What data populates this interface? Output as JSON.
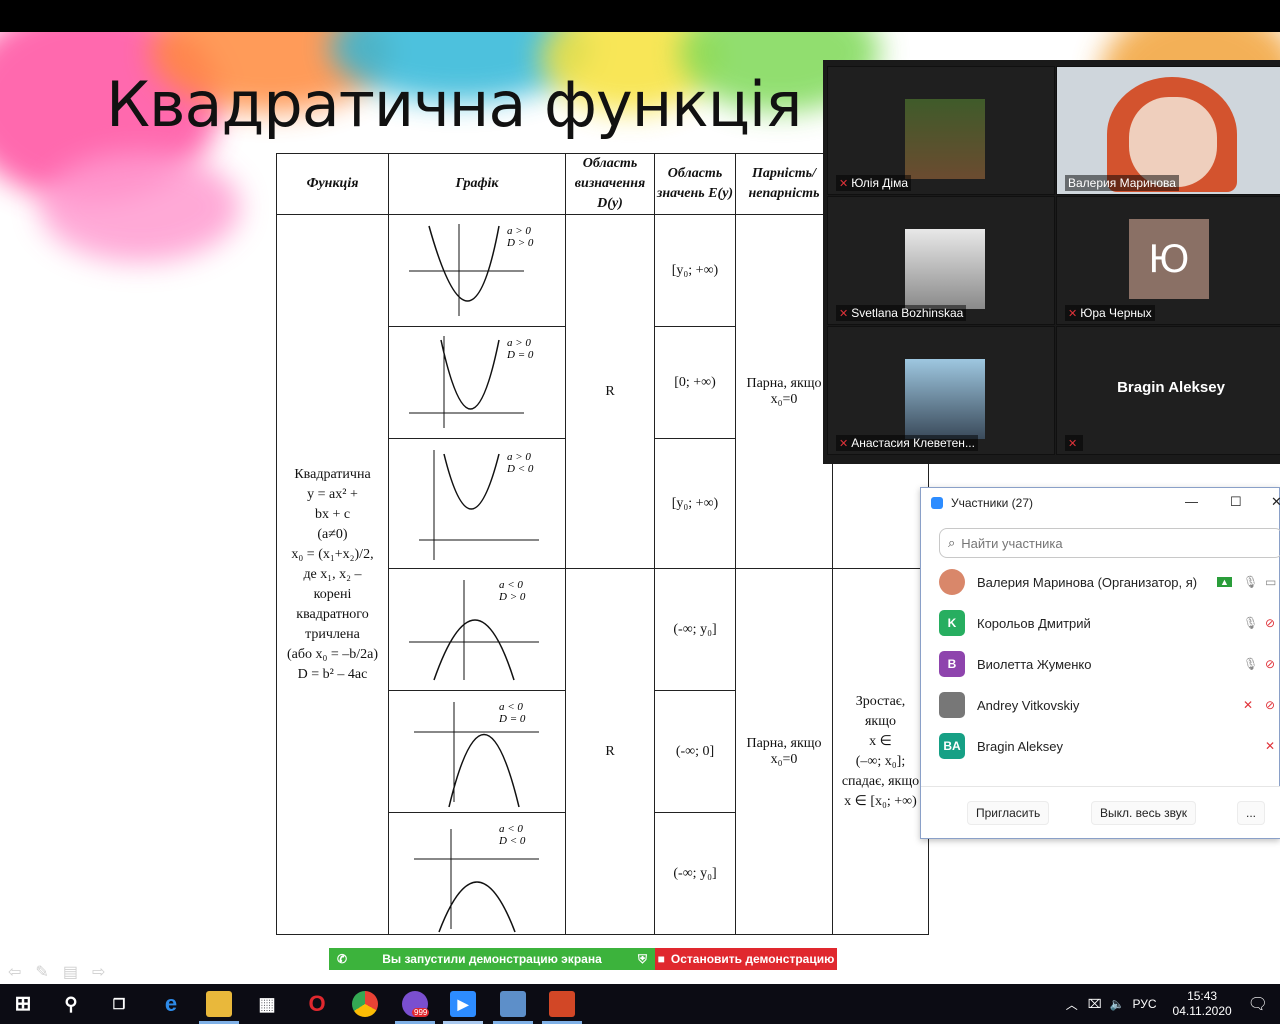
{
  "slide": {
    "title": "Квадратична функція",
    "table": {
      "headers": [
        "Функція",
        "Графік",
        "Область визначення D(y)",
        "Область значень E(y)",
        "Парність/ непарність"
      ],
      "function_cell": [
        "Квадратична",
        "y = ax² +",
        "bx + c",
        "(a≠0)",
        "x₀ = (x₁+x₂)/2,",
        "де x₁, x₂ –",
        "корені",
        "квадратного",
        "тричлена",
        "(або x₀ = –b/2a)",
        "D = b² – 4ac"
      ],
      "graph_labels": [
        {
          "a": "a > 0",
          "d": "D > 0"
        },
        {
          "a": "a > 0",
          "d": "D = 0"
        },
        {
          "a": "a > 0",
          "d": "D < 0"
        },
        {
          "a": "a < 0",
          "d": "D > 0"
        },
        {
          "a": "a < 0",
          "d": "D = 0"
        },
        {
          "a": "a < 0",
          "d": "D < 0"
        }
      ],
      "domain": [
        "R",
        "R"
      ],
      "range": [
        "[y₀; +∞)",
        "[0; +∞)",
        "[y₀; +∞)",
        "(-∞; y₀]",
        "(-∞; 0]",
        "(-∞; y₀]"
      ],
      "parity": [
        "Парна, якщо",
        "x₀=0"
      ],
      "monotonic": [
        "Зростає,",
        "якщо",
        "x ∈",
        "(–∞; x₀];",
        "спадає, якщо",
        "x ∈ [x₀; +∞)"
      ]
    }
  },
  "video": {
    "tiles": [
      {
        "name": "Юлія Діма",
        "muted": true
      },
      {
        "name": "Валерия Маринова",
        "muted": false
      },
      {
        "name": "Svetlana Bozhinskaa",
        "muted": true
      },
      {
        "name": "Юра Черных",
        "muted": true,
        "initial": "Ю"
      },
      {
        "name": "Анастасия Клеветен...",
        "muted": true
      },
      {
        "name": "Bragin Aleksey",
        "muted": true
      }
    ]
  },
  "participants": {
    "title": "Участники (27)",
    "search_placeholder": "Найти участника",
    "list": [
      {
        "name": "Валерия Маринова (Организатор, я)",
        "initials": "",
        "color": "#d9876a"
      },
      {
        "name": "Корольов Дмитрий",
        "initials": "K",
        "color": "#27ae60"
      },
      {
        "name": "Виолетта Жуменко",
        "initials": "B",
        "color": "#8e44ad"
      },
      {
        "name": "Andrey Vitkovskiy",
        "initials": "",
        "color": "#777777"
      },
      {
        "name": "Bragin Aleksey",
        "initials": "BA",
        "color": "#16a085"
      }
    ],
    "invite_label": "Пригласить",
    "mute_all_label": "Выкл. весь звук",
    "more_label": "..."
  },
  "share": {
    "status": "Вы запустили демонстрацию экрана",
    "stop": "Остановить демонстрацию"
  },
  "taskbar": {
    "lang": "РУС",
    "time": "15:43",
    "date": "04.11.2020",
    "viber_badge": "999"
  }
}
